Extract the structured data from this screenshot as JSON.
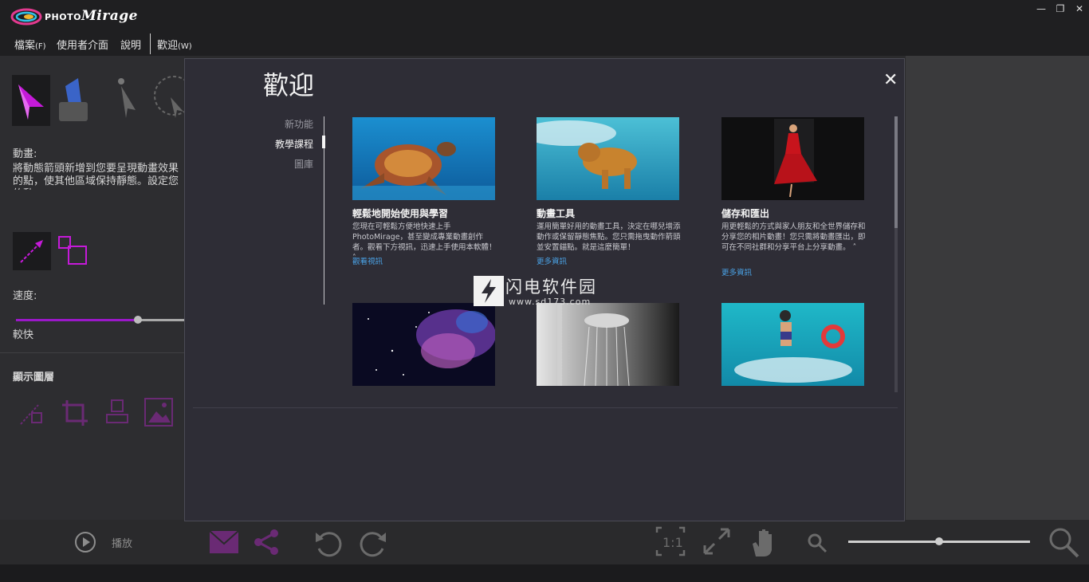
{
  "app": {
    "logo_small": "PHOTO",
    "logo_big": "Mirage"
  },
  "window": {
    "minimize": "—",
    "restore": "❐",
    "close": "✕"
  },
  "menu": [
    {
      "label": "檔案",
      "shortcut": "(F)"
    },
    {
      "label": "使用者介面",
      "shortcut": ""
    },
    {
      "label": "說明",
      "shortcut": ""
    },
    {
      "label": "歡迎",
      "shortcut": "(W)"
    }
  ],
  "left_panel": {
    "animation_title": "動畫:",
    "animation_desc": "將動態箭頭新增到您要呈現動畫效果的點，使其他區域保持靜態。設定您的動",
    "speed_label": "速度:",
    "speed_value_label": "較快",
    "speed_level": 0.72,
    "layers_title": "顯示圖層",
    "tools": [
      "motion-arrow-tool",
      "anchor-tool",
      "select-tool",
      "lasso-tool"
    ],
    "sub_tools": [
      "motion-arrow-subtool",
      "mask-subtool"
    ],
    "layer_icons": [
      "arrows-layer-icon",
      "crop-layer-icon",
      "stamp-layer-icon",
      "image-layer-icon"
    ]
  },
  "bottom_bar": {
    "play_label": "播放",
    "zoom_level": 0.5,
    "buttons": [
      "play",
      "email",
      "share",
      "undo",
      "redo",
      "actual-size",
      "fit",
      "pan",
      "zoom-out",
      "zoom-in"
    ]
  },
  "dialog": {
    "title": "歡迎",
    "close": "✕",
    "nav": [
      {
        "label": "新功能",
        "active": false
      },
      {
        "label": "教學課程",
        "active": true
      },
      {
        "label": "圖庫",
        "active": false
      }
    ],
    "cards": [
      {
        "title": "輕鬆地開始使用與學習",
        "desc": "您現在可輕鬆方便地快速上手 PhotoMirage，甚至變成專業動畫創作者。觀看下方視訊，迅速上手使用本軟體！ ˄",
        "link": "觀看視訊",
        "image": "sea-turtle-photo"
      },
      {
        "title": "動畫工具",
        "desc": "運用簡單好用的動畫工具，決定在哪兒增添動作或保留靜態焦點。您只需拖曳動作箭頭並安置錨點。就是這麼簡單！",
        "link": "更多資訊",
        "image": "swimming-dog-photo"
      },
      {
        "title": "儲存和匯出",
        "desc": "用更輕鬆的方式與家人朋友和全世界儲存和分享您的相片動畫！您只需將動畫匯出，即可在不同社群和分享平台上分享動畫。 ˄",
        "link": "更多資訊",
        "image": "red-dress-photo"
      },
      {
        "title": "",
        "desc": "",
        "link": "",
        "image": "galaxy-photo"
      },
      {
        "title": "",
        "desc": "",
        "link": "",
        "image": "shower-photo"
      },
      {
        "title": "",
        "desc": "",
        "link": "",
        "image": "surfer-photo"
      }
    ]
  },
  "watermark": {
    "main": "闪电软件园",
    "url": "www.sd173.com"
  },
  "colors": {
    "accent": "#9a18c8",
    "link": "#4aa2e6",
    "dialog_bg": "#2e2d36",
    "panel_bg": "#2d2d30"
  }
}
